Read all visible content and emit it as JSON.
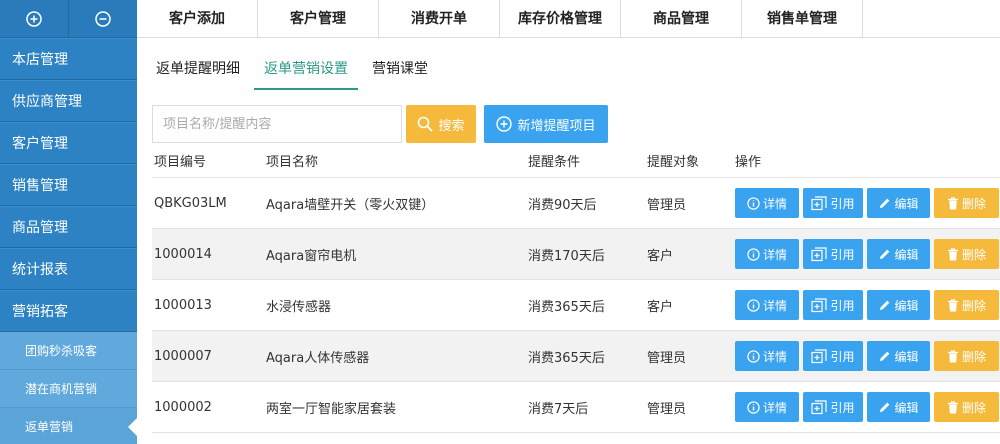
{
  "sidebar": {
    "top_buttons": [
      {
        "icon": "plus-circle-icon"
      },
      {
        "icon": "minus-circle-icon"
      }
    ],
    "items": [
      {
        "label": "本店管理"
      },
      {
        "label": "供应商管理"
      },
      {
        "label": "客户管理"
      },
      {
        "label": "销售管理"
      },
      {
        "label": "商品管理"
      },
      {
        "label": "统计报表"
      },
      {
        "label": "营销拓客"
      }
    ],
    "subitems": [
      {
        "label": "团购秒杀吸客"
      },
      {
        "label": "潜在商机营销"
      },
      {
        "label": "返单营销"
      }
    ]
  },
  "topnav": [
    {
      "label": "客户添加"
    },
    {
      "label": "客户管理"
    },
    {
      "label": "消费开单"
    },
    {
      "label": "库存价格管理"
    },
    {
      "label": "商品管理"
    },
    {
      "label": "销售单管理"
    }
  ],
  "subtabs": [
    {
      "label": "返单提醒明细"
    },
    {
      "label": "返单营销设置"
    },
    {
      "label": "营销课堂"
    }
  ],
  "search": {
    "placeholder": "项目名称/提醒内容",
    "value": "",
    "search_label": "搜索",
    "add_label": "新增提醒项目"
  },
  "colors": {
    "accent_tab": "#2a9a89",
    "primary_btn": "#3aa3f0",
    "warning_btn": "#f5b93c",
    "sidebar": "#2c82c2"
  },
  "table": {
    "headers": [
      "项目编号",
      "项目名称",
      "提醒条件",
      "提醒对象",
      "操作"
    ],
    "actions": {
      "detail": "详情",
      "ref": "引用",
      "edit": "编辑",
      "delete": "删除"
    },
    "rows": [
      {
        "id": "QBKG03LM",
        "name": "Aqara墙壁开关（零火双键）",
        "condition": "消费90天后",
        "target": "管理员"
      },
      {
        "id": "1000014",
        "name": "Aqara窗帘电机",
        "condition": "消费170天后",
        "target": "客户"
      },
      {
        "id": "1000013",
        "name": "水浸传感器",
        "condition": "消费365天后",
        "target": "客户"
      },
      {
        "id": "1000007",
        "name": "Aqara人体传感器",
        "condition": "消费365天后",
        "target": "管理员"
      },
      {
        "id": "1000002",
        "name": "两室一厅智能家居套装",
        "condition": "消费7天后",
        "target": "管理员"
      }
    ]
  }
}
